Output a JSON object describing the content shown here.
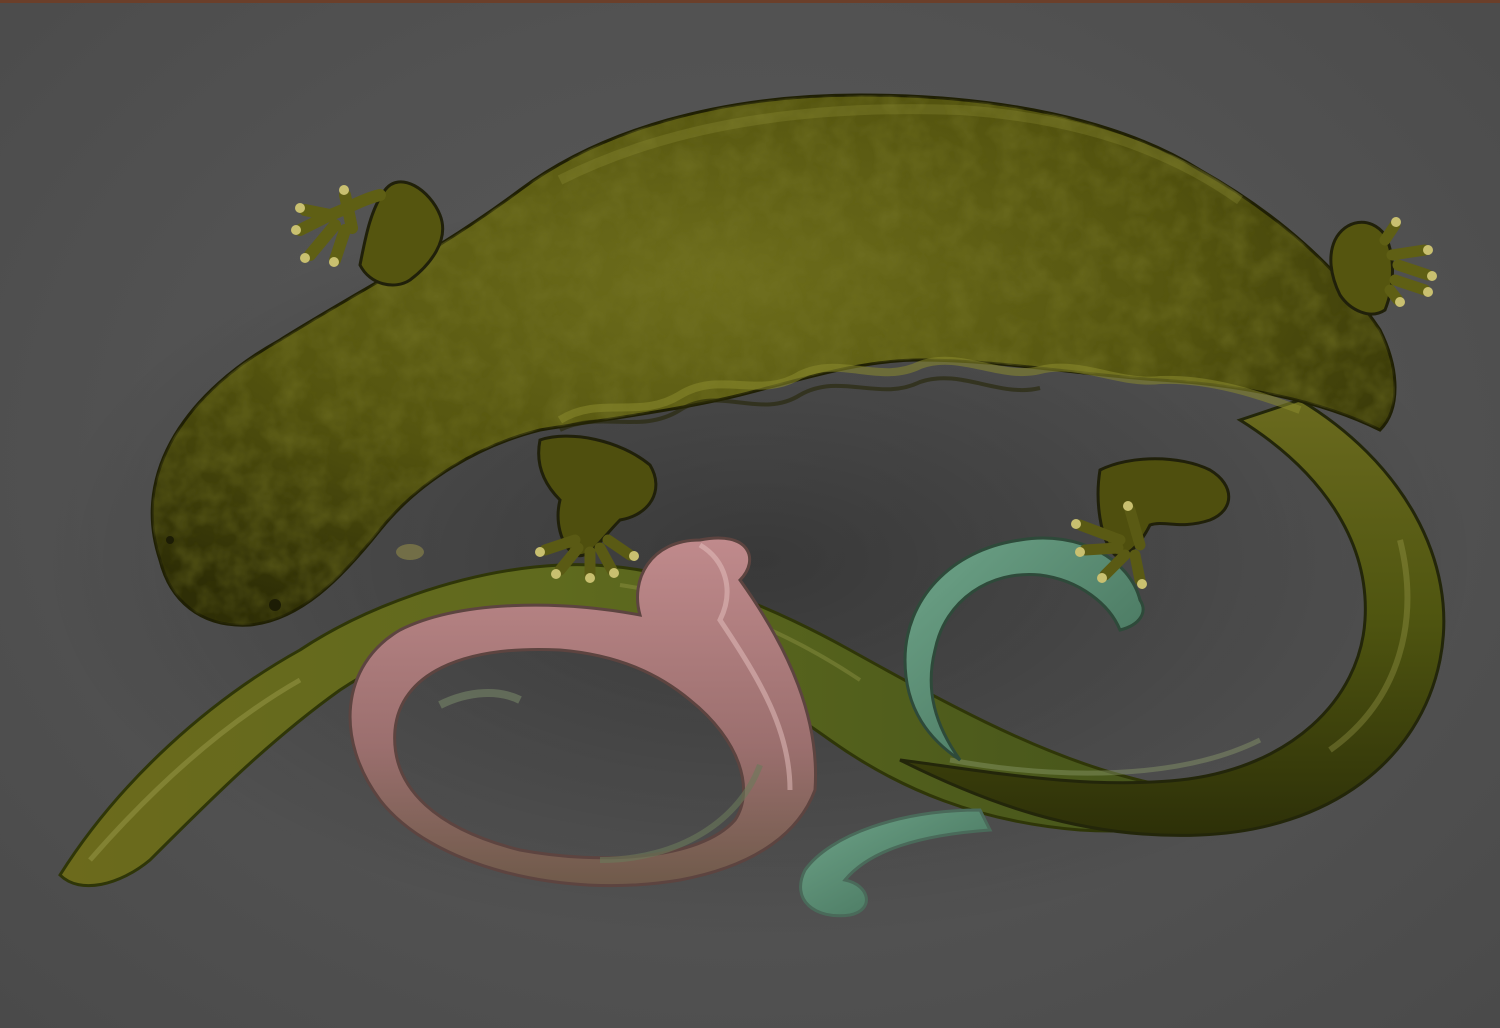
{
  "viewport": {
    "background_color": "#515151",
    "top_border_color": "#6b3f2a"
  },
  "scene": {
    "subject": "salamander-and-tadpoles-sculpt",
    "colors": {
      "salamander_body": "#5a5a14",
      "salamander_dark": "#2f2f08",
      "salamander_highlight": "#9a9a3a",
      "tadpole_olive": "#5d6a1e",
      "tadpole_pink": "#a77a7c",
      "tadpole_green": "#5e8e78"
    }
  }
}
